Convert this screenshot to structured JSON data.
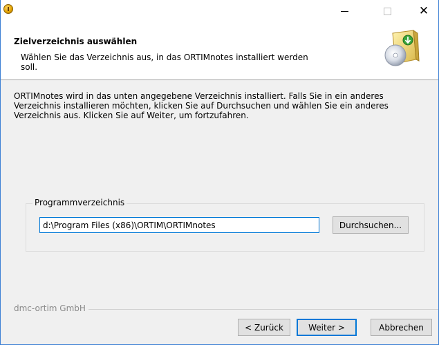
{
  "window": {
    "icon": "setup-icon",
    "controls": {
      "minimize": "—",
      "maximize": "☐",
      "close": "✕"
    }
  },
  "header": {
    "title": "Zielverzeichnis auswählen",
    "subtitle": "Wählen Sie das Verzeichnis aus, in das ORTIMnotes installiert werden soll.",
    "image": "install-disk-icon"
  },
  "intro_text": "ORTIMnotes wird in das unten angegebene Verzeichnis installiert. Falls Sie in ein anderes Verzeichnis installieren möchten, klicken Sie auf Durchsuchen und wählen Sie ein anderes Verzeichnis aus. Klicken Sie auf Weiter, um fortzufahren.",
  "group": {
    "label": "Programmverzeichnis",
    "path_value": "d:\\Program Files (x86)\\ORTIM\\ORTIMnotes",
    "browse_label": "Durchsuchen..."
  },
  "footer": {
    "brand": "dmc-ortim GmbH",
    "back_label": "< Zurück",
    "next_label": "Weiter >",
    "cancel_label": "Abbrechen"
  },
  "colors": {
    "accent": "#0078d7",
    "window_border": "#3b7fd4",
    "dialog_bg": "#f0f0f0",
    "header_bg": "#ffffff"
  }
}
